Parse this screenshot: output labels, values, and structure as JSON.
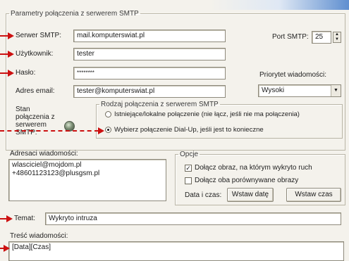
{
  "smtp_group": {
    "title": "Parametry połączenia z serwerem SMTP",
    "server_label": "Serwer SMTP:",
    "server_value": "mail.komputerswiat.pl",
    "user_label": "Użytkownik:",
    "user_value": "tester",
    "password_label": "Hasło:",
    "password_value": "********",
    "email_label": "Adres email:",
    "email_value": "tester@komputerswiat.pl",
    "port_label": "Port SMTP:",
    "port_value": "25",
    "priority_label": "Priorytet wiadomości:",
    "priority_value": "Wysoki",
    "status_label": "Stan połączenia z serwerem SMTP:",
    "connection_group": {
      "title": "Rodzaj połączenia z serwerem SMTP",
      "option_lan": "Istniejące/lokalne połączenie (nie łącz, jeśli nie ma połączenia)",
      "option_dialup": "Wybierz połączenie Dial-Up, jeśli jest to konieczne",
      "selected": "dialup"
    }
  },
  "recipients": {
    "label": "Adresaci wiadomości:",
    "lines": [
      "wlasciciel@mojdom.pl",
      "+48601123123@plusgsm.pl"
    ]
  },
  "options": {
    "title": "Opcje",
    "attach_image_label": "Dołącz obraz, na którym wykryto ruch",
    "attach_image_checked": true,
    "attach_both_label": "Dołącz oba porównywane obrazy",
    "attach_both_checked": false,
    "datetime_label": "Data i czas:",
    "insert_date_button": "Wstaw datę",
    "insert_time_button": "Wstaw czas"
  },
  "subject": {
    "label": "Temat:",
    "value": "Wykryto intruza"
  },
  "body": {
    "label": "Treść wiadomości:",
    "value": "[Data][Czas]"
  },
  "colors": {
    "annotation_arrow": "#cc1111",
    "window_bg": "#f4f2ec"
  }
}
